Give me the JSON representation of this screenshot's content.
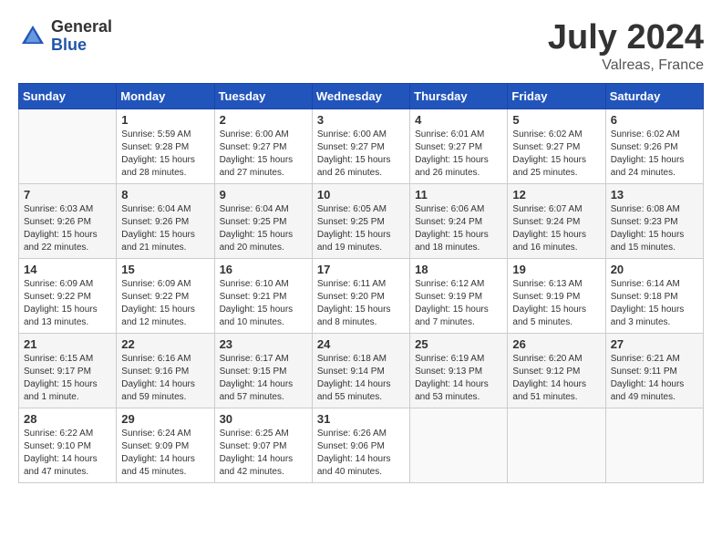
{
  "logo": {
    "general": "General",
    "blue": "Blue"
  },
  "title": {
    "month": "July 2024",
    "location": "Valreas, France"
  },
  "headers": [
    "Sunday",
    "Monday",
    "Tuesday",
    "Wednesday",
    "Thursday",
    "Friday",
    "Saturday"
  ],
  "weeks": [
    [
      {
        "day": "",
        "info": ""
      },
      {
        "day": "1",
        "info": "Sunrise: 5:59 AM\nSunset: 9:28 PM\nDaylight: 15 hours\nand 28 minutes."
      },
      {
        "day": "2",
        "info": "Sunrise: 6:00 AM\nSunset: 9:27 PM\nDaylight: 15 hours\nand 27 minutes."
      },
      {
        "day": "3",
        "info": "Sunrise: 6:00 AM\nSunset: 9:27 PM\nDaylight: 15 hours\nand 26 minutes."
      },
      {
        "day": "4",
        "info": "Sunrise: 6:01 AM\nSunset: 9:27 PM\nDaylight: 15 hours\nand 26 minutes."
      },
      {
        "day": "5",
        "info": "Sunrise: 6:02 AM\nSunset: 9:27 PM\nDaylight: 15 hours\nand 25 minutes."
      },
      {
        "day": "6",
        "info": "Sunrise: 6:02 AM\nSunset: 9:26 PM\nDaylight: 15 hours\nand 24 minutes."
      }
    ],
    [
      {
        "day": "7",
        "info": "Sunrise: 6:03 AM\nSunset: 9:26 PM\nDaylight: 15 hours\nand 22 minutes."
      },
      {
        "day": "8",
        "info": "Sunrise: 6:04 AM\nSunset: 9:26 PM\nDaylight: 15 hours\nand 21 minutes."
      },
      {
        "day": "9",
        "info": "Sunrise: 6:04 AM\nSunset: 9:25 PM\nDaylight: 15 hours\nand 20 minutes."
      },
      {
        "day": "10",
        "info": "Sunrise: 6:05 AM\nSunset: 9:25 PM\nDaylight: 15 hours\nand 19 minutes."
      },
      {
        "day": "11",
        "info": "Sunrise: 6:06 AM\nSunset: 9:24 PM\nDaylight: 15 hours\nand 18 minutes."
      },
      {
        "day": "12",
        "info": "Sunrise: 6:07 AM\nSunset: 9:24 PM\nDaylight: 15 hours\nand 16 minutes."
      },
      {
        "day": "13",
        "info": "Sunrise: 6:08 AM\nSunset: 9:23 PM\nDaylight: 15 hours\nand 15 minutes."
      }
    ],
    [
      {
        "day": "14",
        "info": "Sunrise: 6:09 AM\nSunset: 9:22 PM\nDaylight: 15 hours\nand 13 minutes."
      },
      {
        "day": "15",
        "info": "Sunrise: 6:09 AM\nSunset: 9:22 PM\nDaylight: 15 hours\nand 12 minutes."
      },
      {
        "day": "16",
        "info": "Sunrise: 6:10 AM\nSunset: 9:21 PM\nDaylight: 15 hours\nand 10 minutes."
      },
      {
        "day": "17",
        "info": "Sunrise: 6:11 AM\nSunset: 9:20 PM\nDaylight: 15 hours\nand 8 minutes."
      },
      {
        "day": "18",
        "info": "Sunrise: 6:12 AM\nSunset: 9:19 PM\nDaylight: 15 hours\nand 7 minutes."
      },
      {
        "day": "19",
        "info": "Sunrise: 6:13 AM\nSunset: 9:19 PM\nDaylight: 15 hours\nand 5 minutes."
      },
      {
        "day": "20",
        "info": "Sunrise: 6:14 AM\nSunset: 9:18 PM\nDaylight: 15 hours\nand 3 minutes."
      }
    ],
    [
      {
        "day": "21",
        "info": "Sunrise: 6:15 AM\nSunset: 9:17 PM\nDaylight: 15 hours\nand 1 minute."
      },
      {
        "day": "22",
        "info": "Sunrise: 6:16 AM\nSunset: 9:16 PM\nDaylight: 14 hours\nand 59 minutes."
      },
      {
        "day": "23",
        "info": "Sunrise: 6:17 AM\nSunset: 9:15 PM\nDaylight: 14 hours\nand 57 minutes."
      },
      {
        "day": "24",
        "info": "Sunrise: 6:18 AM\nSunset: 9:14 PM\nDaylight: 14 hours\nand 55 minutes."
      },
      {
        "day": "25",
        "info": "Sunrise: 6:19 AM\nSunset: 9:13 PM\nDaylight: 14 hours\nand 53 minutes."
      },
      {
        "day": "26",
        "info": "Sunrise: 6:20 AM\nSunset: 9:12 PM\nDaylight: 14 hours\nand 51 minutes."
      },
      {
        "day": "27",
        "info": "Sunrise: 6:21 AM\nSunset: 9:11 PM\nDaylight: 14 hours\nand 49 minutes."
      }
    ],
    [
      {
        "day": "28",
        "info": "Sunrise: 6:22 AM\nSunset: 9:10 PM\nDaylight: 14 hours\nand 47 minutes."
      },
      {
        "day": "29",
        "info": "Sunrise: 6:24 AM\nSunset: 9:09 PM\nDaylight: 14 hours\nand 45 minutes."
      },
      {
        "day": "30",
        "info": "Sunrise: 6:25 AM\nSunset: 9:07 PM\nDaylight: 14 hours\nand 42 minutes."
      },
      {
        "day": "31",
        "info": "Sunrise: 6:26 AM\nSunset: 9:06 PM\nDaylight: 14 hours\nand 40 minutes."
      },
      {
        "day": "",
        "info": ""
      },
      {
        "day": "",
        "info": ""
      },
      {
        "day": "",
        "info": ""
      }
    ]
  ]
}
